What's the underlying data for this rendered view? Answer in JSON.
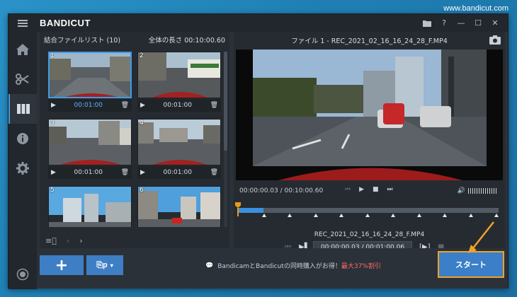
{
  "watermark": "www.bandicut.com",
  "titlebar": {
    "logo_bandi": "BANDI",
    "logo_cut": "CUT",
    "help": "?",
    "minimize": "—",
    "maximize": "☐",
    "close": "✕"
  },
  "left_panel": {
    "title": "結合ファイルリスト (10)",
    "total_length": "全体の長さ 00:10:00.60",
    "thumbnails": [
      {
        "num": "1",
        "duration": "00:01:00"
      },
      {
        "num": "2",
        "duration": "00:01:00"
      },
      {
        "num": "3",
        "duration": "00:01:00"
      },
      {
        "num": "4",
        "duration": "00:01:00"
      },
      {
        "num": "5",
        "duration": ""
      },
      {
        "num": "6",
        "duration": ""
      }
    ]
  },
  "right_panel": {
    "file_title": "ファイル 1 - REC_2021_02_16_16_24_28_F.MP4",
    "time_display": "00:00:00.03 / 00:10:00.60",
    "segment_filename": "REC_2021_02_16_16_24_28_F.MP4",
    "segment_time": "00:00:00.03 / 00:01:00.06",
    "progress_fraction": 0.0
  },
  "bottom": {
    "add_label": "+",
    "format_label": "⎘p",
    "promo_text": "BandicamとBandicutの同時購入がお得！",
    "promo_highlight": "最大37%割引",
    "start_label": "スタート"
  },
  "colors": {
    "accent": "#3b8fe0",
    "button_blue": "#3e7ec4",
    "highlight_orange": "#f0a22a",
    "promo_red": "#ff6a6a"
  }
}
